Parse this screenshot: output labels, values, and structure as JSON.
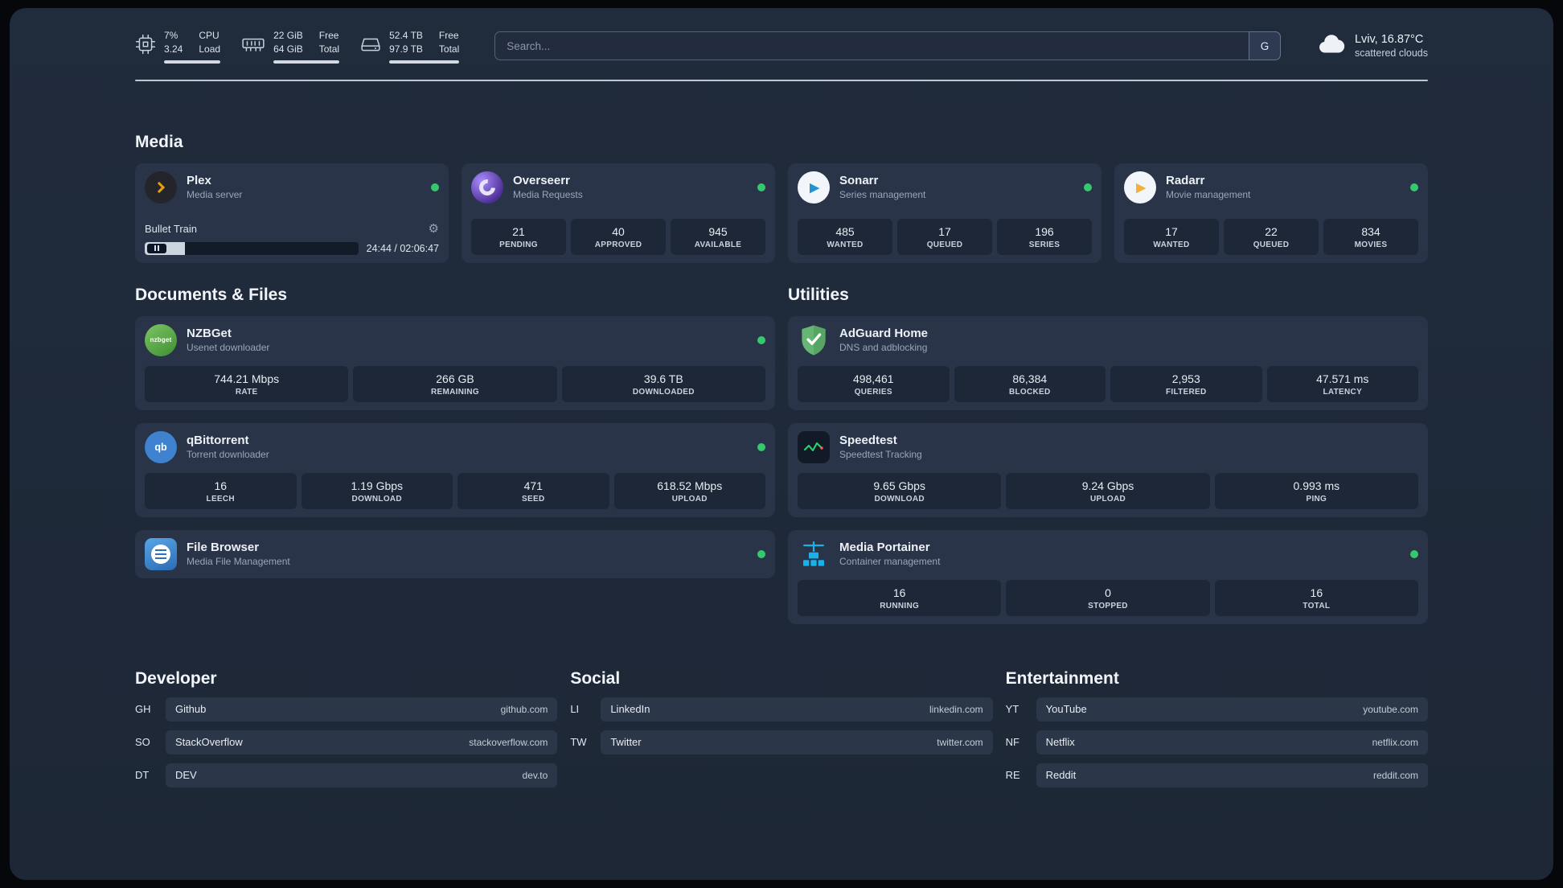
{
  "colors": {
    "status_online": "#35c86d"
  },
  "topbar": {
    "resources": [
      {
        "icon": "cpu-icon",
        "primary": "7%",
        "secondary": "3.24",
        "label_primary": "CPU",
        "label_secondary": "Load",
        "progress_pct": 100
      },
      {
        "icon": "memory-icon",
        "primary": "22 GiB",
        "secondary": "64 GiB",
        "label_primary": "Free",
        "label_secondary": "Total",
        "progress_pct": 100
      },
      {
        "icon": "disk-icon",
        "primary": "52.4 TB",
        "secondary": "97.9 TB",
        "label_primary": "Free",
        "label_secondary": "Total",
        "progress_pct": 100
      }
    ],
    "search": {
      "placeholder": "Search...",
      "provider_button": "G"
    },
    "weather": {
      "location": "Lviv, 16.87°C",
      "condition": "scattered clouds"
    }
  },
  "media": {
    "title": "Media",
    "plex": {
      "name": "Plex",
      "subtitle": "Media server",
      "now_playing": "Bullet Train",
      "time": "24:44 / 02:06:47",
      "progress_pct": 19
    },
    "overseerr": {
      "name": "Overseerr",
      "subtitle": "Media Requests",
      "stats": [
        {
          "value": "21",
          "label": "PENDING"
        },
        {
          "value": "40",
          "label": "APPROVED"
        },
        {
          "value": "945",
          "label": "AVAILABLE"
        }
      ]
    },
    "sonarr": {
      "name": "Sonarr",
      "subtitle": "Series management",
      "stats": [
        {
          "value": "485",
          "label": "WANTED"
        },
        {
          "value": "17",
          "label": "QUEUED"
        },
        {
          "value": "196",
          "label": "SERIES"
        }
      ]
    },
    "radarr": {
      "name": "Radarr",
      "subtitle": "Movie management",
      "stats": [
        {
          "value": "17",
          "label": "WANTED"
        },
        {
          "value": "22",
          "label": "QUEUED"
        },
        {
          "value": "834",
          "label": "MOVIES"
        }
      ]
    }
  },
  "documents": {
    "title": "Documents & Files",
    "nzbget": {
      "name": "NZBGet",
      "subtitle": "Usenet downloader",
      "icon_text": "nzbget",
      "stats": [
        {
          "value": "744.21 Mbps",
          "label": "RATE"
        },
        {
          "value": "266 GB",
          "label": "REMAINING"
        },
        {
          "value": "39.6 TB",
          "label": "DOWNLOADED"
        }
      ]
    },
    "qbittorrent": {
      "name": "qBittorrent",
      "subtitle": "Torrent downloader",
      "icon_text": "qb",
      "stats": [
        {
          "value": "16",
          "label": "LEECH"
        },
        {
          "value": "1.19 Gbps",
          "label": "DOWNLOAD"
        },
        {
          "value": "471",
          "label": "SEED"
        },
        {
          "value": "618.52 Mbps",
          "label": "UPLOAD"
        }
      ]
    },
    "filebrowser": {
      "name": "File Browser",
      "subtitle": "Media File Management"
    }
  },
  "utilities": {
    "title": "Utilities",
    "adguard": {
      "name": "AdGuard Home",
      "subtitle": "DNS and adblocking",
      "stats": [
        {
          "value": "498,461",
          "label": "QUERIES"
        },
        {
          "value": "86,384",
          "label": "BLOCKED"
        },
        {
          "value": "2,953",
          "label": "FILTERED"
        },
        {
          "value": "47.571 ms",
          "label": "LATENCY"
        }
      ]
    },
    "speedtest": {
      "name": "Speedtest",
      "subtitle": "Speedtest Tracking",
      "stats": [
        {
          "value": "9.65 Gbps",
          "label": "DOWNLOAD"
        },
        {
          "value": "9.24 Gbps",
          "label": "UPLOAD"
        },
        {
          "value": "0.993 ms",
          "label": "PING"
        }
      ]
    },
    "portainer": {
      "name": "Media Portainer",
      "subtitle": "Container management",
      "stats": [
        {
          "value": "16",
          "label": "RUNNING"
        },
        {
          "value": "0",
          "label": "STOPPED"
        },
        {
          "value": "16",
          "label": "TOTAL"
        }
      ]
    }
  },
  "bookmarks": {
    "developer": {
      "title": "Developer",
      "items": [
        {
          "abbr": "GH",
          "name": "Github",
          "domain": "github.com"
        },
        {
          "abbr": "SO",
          "name": "StackOverflow",
          "domain": "stackoverflow.com"
        },
        {
          "abbr": "DT",
          "name": "DEV",
          "domain": "dev.to"
        }
      ]
    },
    "social": {
      "title": "Social",
      "items": [
        {
          "abbr": "LI",
          "name": "LinkedIn",
          "domain": "linkedin.com"
        },
        {
          "abbr": "TW",
          "name": "Twitter",
          "domain": "twitter.com"
        }
      ]
    },
    "entertainment": {
      "title": "Entertainment",
      "items": [
        {
          "abbr": "YT",
          "name": "YouTube",
          "domain": "youtube.com"
        },
        {
          "abbr": "NF",
          "name": "Netflix",
          "domain": "netflix.com"
        },
        {
          "abbr": "RE",
          "name": "Reddit",
          "domain": "reddit.com"
        }
      ]
    }
  }
}
